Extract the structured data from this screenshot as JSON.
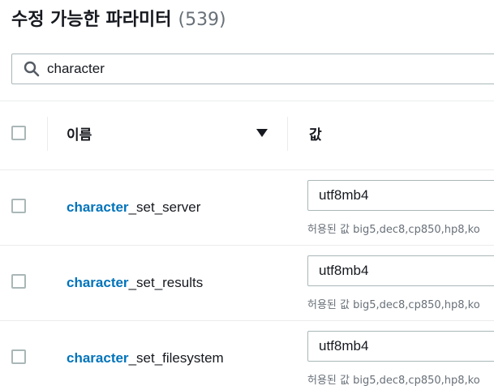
{
  "header": {
    "title": "수정 가능한 파라미터",
    "count": "(539)"
  },
  "search": {
    "value": "character",
    "icon": "search-icon"
  },
  "table": {
    "columns": {
      "name": "이름",
      "value": "값"
    },
    "rows": [
      {
        "name_match": "character",
        "name_rest": "_set_server",
        "value": "utf8mb4",
        "allowed": "허용된 값 big5,dec8,cp850,hp8,ko"
      },
      {
        "name_match": "character",
        "name_rest": "_set_results",
        "value": "utf8mb4",
        "allowed": "허용된 값 big5,dec8,cp850,hp8,ko"
      },
      {
        "name_match": "character",
        "name_rest": "_set_filesystem",
        "value": "utf8mb4",
        "allowed": "허용된 값 big5,dec8,cp850,hp8,ko"
      }
    ]
  },
  "colors": {
    "accent": "#0073bb",
    "text": "#16191f",
    "muted": "#687078",
    "border": "#aab7b8"
  }
}
